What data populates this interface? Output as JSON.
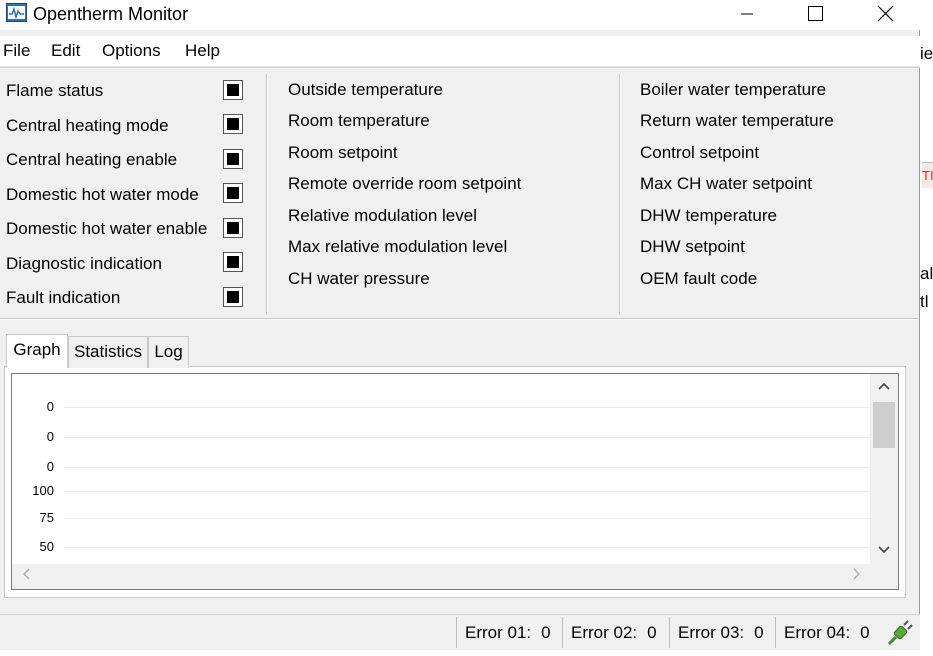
{
  "window": {
    "title": "Opentherm Monitor"
  },
  "menu": [
    "File",
    "Edit",
    "Options",
    "Help"
  ],
  "status_flags": [
    {
      "label": "Flame status"
    },
    {
      "label": "Central heating mode"
    },
    {
      "label": "Central heating enable"
    },
    {
      "label": "Domestic hot water mode"
    },
    {
      "label": "Domestic hot water enable"
    },
    {
      "label": "Diagnostic indication"
    },
    {
      "label": "Fault indication"
    }
  ],
  "middle_values": [
    "Outside temperature",
    "Room temperature",
    "Room setpoint",
    "Remote override room setpoint",
    "Relative modulation level",
    "Max relative modulation level",
    "CH water pressure"
  ],
  "right_values": [
    "Boiler water temperature",
    "Return water temperature",
    "Control setpoint",
    "Max CH water setpoint",
    "DHW temperature",
    "DHW setpoint",
    "OEM fault code"
  ],
  "tabs": [
    {
      "label": "Graph",
      "active": true
    },
    {
      "label": "Statistics",
      "active": false
    },
    {
      "label": "Log",
      "active": false
    }
  ],
  "graph": {
    "tick_labels": [
      "0",
      "0",
      "0",
      "100",
      "75",
      "50"
    ]
  },
  "errors": [
    {
      "label": "Error 01:",
      "value": "0"
    },
    {
      "label": "Error 02:",
      "value": "0"
    },
    {
      "label": "Error 03:",
      "value": "0"
    },
    {
      "label": "Error 04:",
      "value": "0"
    }
  ],
  "background_fragments": [
    "ie",
    "TI",
    "al",
    "tl"
  ],
  "icons": {
    "app": "opentherm-app-icon",
    "connection": "plug-connection-icon"
  },
  "colors": {
    "accent": "#2f6fb5",
    "connection": "#3f8f2f"
  }
}
